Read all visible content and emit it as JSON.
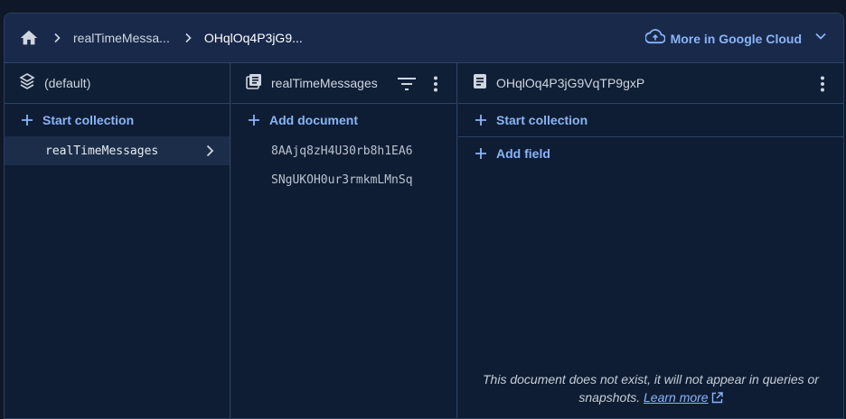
{
  "breadcrumb": {
    "home_icon": "home-icon",
    "items": [
      "realTimeMessa...",
      "OHqlOq4P3jG9..."
    ]
  },
  "header": {
    "more_cloud_label": "More in Google Cloud",
    "cloud_icon": "cloud-icon",
    "expand_icon": "chevron-down-icon"
  },
  "panes": {
    "root": {
      "title": "(default)",
      "icon": "database-stack-icon",
      "action_label": "Start collection",
      "collections": [
        "realTimeMessages"
      ]
    },
    "collection": {
      "title": "realTimeMessages",
      "icon": "collection-icon",
      "action_label": "Add document",
      "documents": [
        "8AAjq8zH4U30rb8h1EA6",
        "SNgUKOH0ur3rmkmLMnSq"
      ]
    },
    "document": {
      "title": "OHqlOq4P3jG9VqTP9gxP",
      "icon": "document-icon",
      "start_collection_label": "Start collection",
      "add_field_label": "Add field",
      "notice_text": "This document does not exist, it will not appear in queries or snapshots.",
      "learn_more_label": "Learn more"
    }
  },
  "colors": {
    "accent": "#8ab4f8",
    "background": "#0e1d33",
    "header_bg": "#18294a"
  }
}
